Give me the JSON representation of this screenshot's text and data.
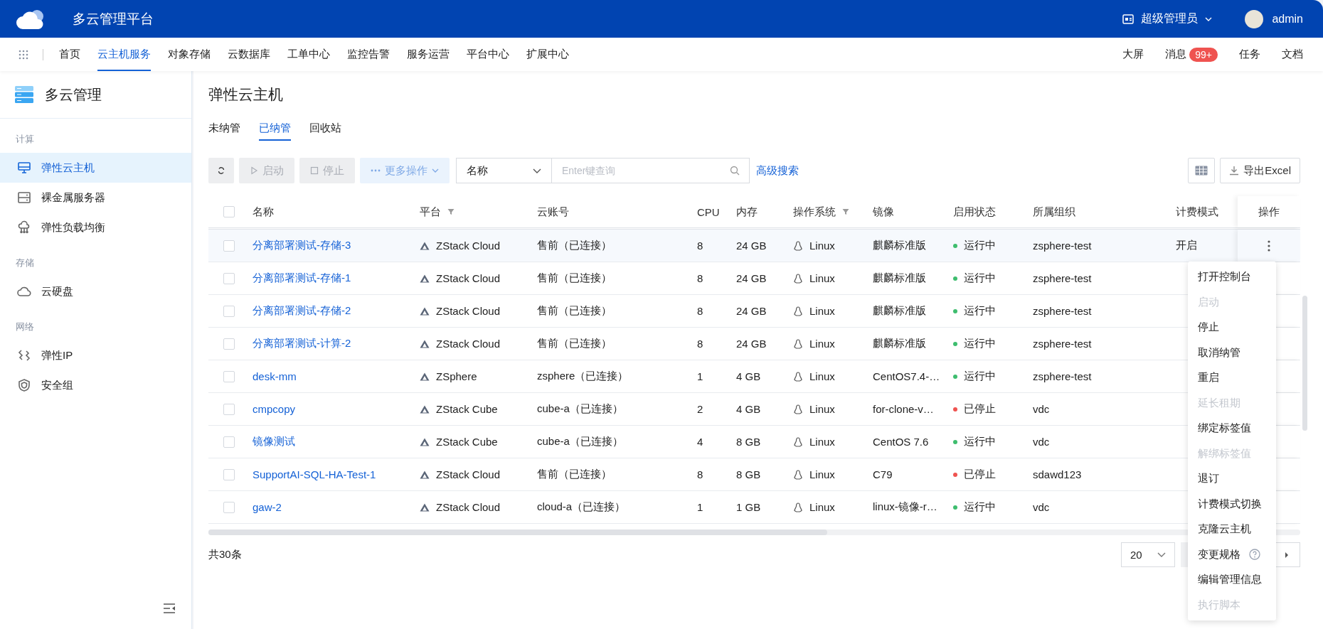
{
  "header": {
    "title": "多云管理平台",
    "role": "超级管理员",
    "user": "admin"
  },
  "nav": {
    "items": [
      {
        "label": "首页",
        "selected": false
      },
      {
        "label": "云主机服务",
        "selected": true
      },
      {
        "label": "对象存储",
        "selected": false
      },
      {
        "label": "云数据库",
        "selected": false
      },
      {
        "label": "工单中心",
        "selected": false
      },
      {
        "label": "监控告警",
        "selected": false
      },
      {
        "label": "服务运营",
        "selected": false
      },
      {
        "label": "平台中心",
        "selected": false
      },
      {
        "label": "扩展中心",
        "selected": false
      }
    ],
    "links": [
      {
        "label": "大屏"
      },
      {
        "label": "消息",
        "badge": "99+"
      },
      {
        "label": "任务"
      },
      {
        "label": "文档"
      }
    ]
  },
  "sidebar": {
    "title": "多云管理",
    "groups": [
      {
        "label": "计算",
        "items": [
          {
            "label": "弹性云主机",
            "selected": true
          },
          {
            "label": "裸金属服务器",
            "selected": false
          },
          {
            "label": "弹性负载均衡",
            "selected": false
          }
        ]
      },
      {
        "label": "存储",
        "items": [
          {
            "label": "云硬盘",
            "selected": false
          }
        ]
      },
      {
        "label": "网络",
        "items": [
          {
            "label": "弹性IP",
            "selected": false
          },
          {
            "label": "安全组",
            "selected": false
          }
        ]
      }
    ]
  },
  "page": {
    "title": "弹性云主机",
    "tabs": [
      {
        "label": "未纳管",
        "selected": false
      },
      {
        "label": "已纳管",
        "selected": true
      },
      {
        "label": "回收站",
        "selected": false
      }
    ]
  },
  "toolbar": {
    "buttons": [
      {
        "kind": "refresh"
      },
      {
        "kind": "start",
        "label": "启动",
        "disabled": true
      },
      {
        "kind": "stop",
        "label": "停止",
        "disabled": true
      },
      {
        "kind": "more",
        "label": "更多操作",
        "disabled": true
      }
    ],
    "search_field": "名称",
    "search": {
      "placeholder": "Enter键查询"
    },
    "advanced_search": "高级搜索",
    "export": "导出Excel"
  },
  "table": {
    "all_checked": false,
    "columns": [
      {
        "label": "名称",
        "filter": false
      },
      {
        "label": "平台",
        "filter": true
      },
      {
        "label": "云账号",
        "filter": false
      },
      {
        "label": "CPU",
        "filter": false
      },
      {
        "label": "内存",
        "filter": false
      },
      {
        "label": "操作系统",
        "filter": true
      },
      {
        "label": "镜像",
        "filter": false
      },
      {
        "label": "启用状态",
        "filter": false
      },
      {
        "label": "所属组织",
        "filter": false
      },
      {
        "label": "计费模式",
        "filter": false
      },
      {
        "label": "操作",
        "filter": false
      }
    ],
    "rows": [
      {
        "checked": false,
        "active": true,
        "name": "分离部署测试-存储-3",
        "platform": "ZStack Cloud",
        "account": "售前（已连接）",
        "cpu": "8",
        "memory": "24 GB",
        "os": "Linux",
        "image": "麒麟标准版",
        "status": {
          "label": "运行中",
          "color": "#3ebd6e"
        },
        "org": "zsphere-test",
        "billing": "开启"
      },
      {
        "checked": false,
        "active": false,
        "name": "分离部署测试-存储-1",
        "platform": "ZStack Cloud",
        "account": "售前（已连接）",
        "cpu": "8",
        "memory": "24 GB",
        "os": "Linux",
        "image": "麒麟标准版",
        "status": {
          "label": "运行中",
          "color": "#3ebd6e"
        },
        "org": "zsphere-test"
      },
      {
        "checked": false,
        "active": false,
        "name": "分离部署测试-存储-2",
        "platform": "ZStack Cloud",
        "account": "售前（已连接）",
        "cpu": "8",
        "memory": "24 GB",
        "os": "Linux",
        "image": "麒麟标准版",
        "status": {
          "label": "运行中",
          "color": "#3ebd6e"
        },
        "org": "zsphere-test"
      },
      {
        "checked": false,
        "active": false,
        "name": "分离部署测试-计算-2",
        "platform": "ZStack Cloud",
        "account": "售前（已连接）",
        "cpu": "8",
        "memory": "24 GB",
        "os": "Linux",
        "image": "麒麟标准版",
        "status": {
          "label": "运行中",
          "color": "#3ebd6e"
        },
        "org": "zsphere-test"
      },
      {
        "checked": false,
        "active": false,
        "name": "desk-mm",
        "platform": "ZSphere",
        "account": "zsphere（已连接）",
        "cpu": "1",
        "memory": "4 GB",
        "os": "Linux",
        "image": "CentOS7.4-…",
        "status": {
          "label": "运行中",
          "color": "#3ebd6e"
        },
        "org": "zsphere-test"
      },
      {
        "checked": false,
        "active": false,
        "name": "cmpcopy",
        "platform": "ZStack Cube",
        "account": "cube-a（已连接）",
        "cpu": "2",
        "memory": "4 GB",
        "os": "Linux",
        "image": "for-clone-v…",
        "status": {
          "label": "已停止",
          "color": "#ef5350"
        },
        "org": "vdc"
      },
      {
        "checked": false,
        "active": false,
        "name": "镜像测试",
        "platform": "ZStack Cube",
        "account": "cube-a（已连接）",
        "cpu": "4",
        "memory": "8 GB",
        "os": "Linux",
        "image": "CentOS 7.6",
        "status": {
          "label": "运行中",
          "color": "#3ebd6e"
        },
        "org": "vdc"
      },
      {
        "checked": false,
        "active": false,
        "name": "SupportAI-SQL-HA-Test-1",
        "platform": "ZStack Cloud",
        "account": "售前（已连接）",
        "cpu": "8",
        "memory": "8 GB",
        "os": "Linux",
        "image": "C79",
        "status": {
          "label": "已停止",
          "color": "#ef5350"
        },
        "org": "sdawd123"
      },
      {
        "checked": false,
        "active": false,
        "name": "gaw-2",
        "platform": "ZStack Cloud",
        "account": "cloud-a（已连接）",
        "cpu": "1",
        "memory": "1 GB",
        "os": "Linux",
        "image": "linux-镜像-r…",
        "status": {
          "label": "运行中",
          "color": "#3ebd6e"
        },
        "org": "vdc"
      }
    ],
    "total": "共30条"
  },
  "actions_menu": [
    {
      "label": "打开控制台",
      "disabled": false,
      "help": false
    },
    {
      "label": "启动",
      "disabled": true,
      "help": false
    },
    {
      "label": "停止",
      "disabled": false,
      "help": false
    },
    {
      "label": "取消纳管",
      "disabled": false,
      "help": false
    },
    {
      "label": "重启",
      "disabled": false,
      "help": false
    },
    {
      "label": "延长租期",
      "disabled": true,
      "help": false
    },
    {
      "label": "绑定标签值",
      "disabled": false,
      "help": false
    },
    {
      "label": "解绑标签值",
      "disabled": true,
      "help": false
    },
    {
      "label": "退订",
      "disabled": false,
      "help": false
    },
    {
      "label": "计费模式切换",
      "disabled": false,
      "help": false
    },
    {
      "label": "克隆云主机",
      "disabled": false,
      "help": false
    },
    {
      "label": "变更规格",
      "disabled": false,
      "help": true
    },
    {
      "label": "编辑管理信息",
      "disabled": false,
      "help": false
    },
    {
      "label": "执行脚本",
      "disabled": true,
      "help": false
    }
  ],
  "pagination": {
    "page_size": "20"
  }
}
